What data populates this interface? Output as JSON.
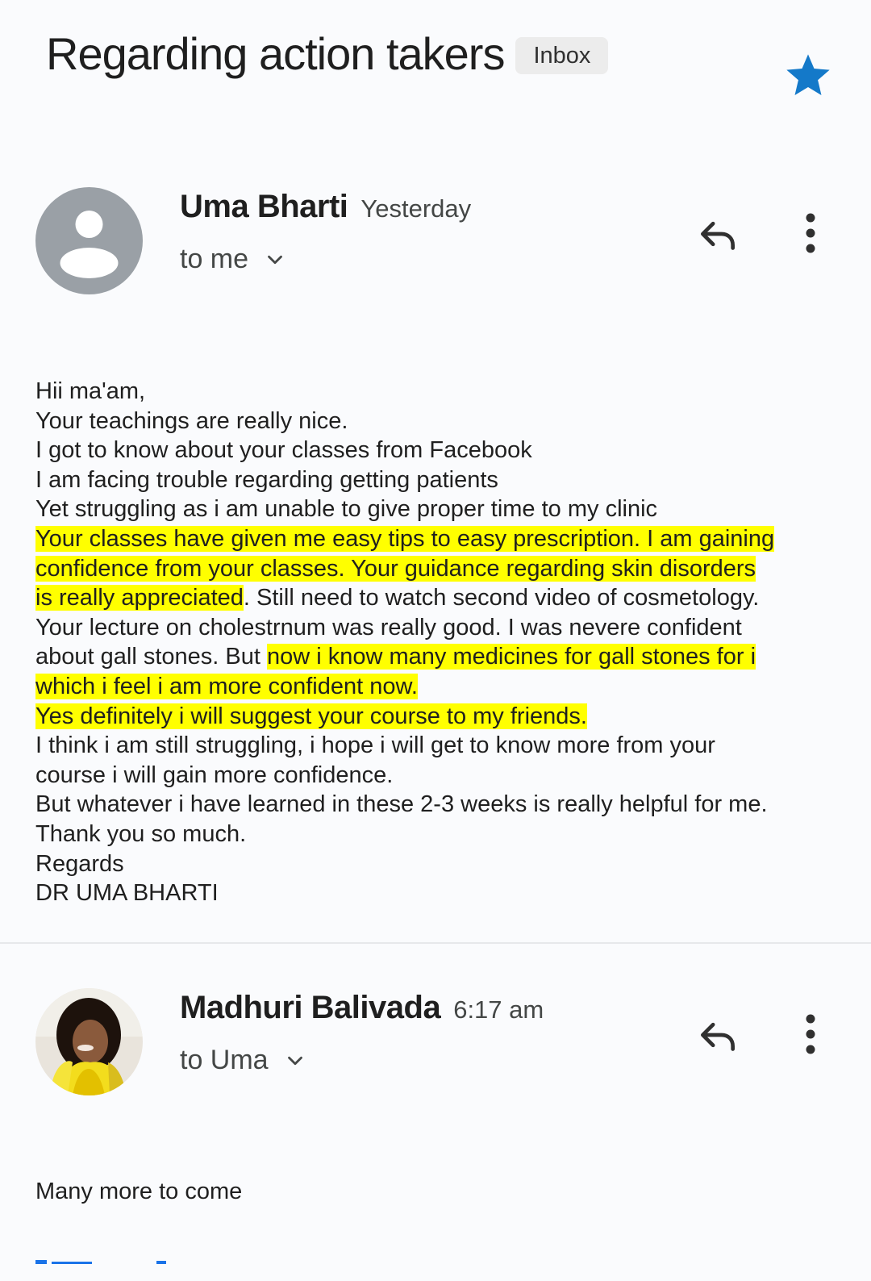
{
  "header": {
    "subject": "Regarding action takers",
    "label_badge": "Inbox",
    "star_icon": "star-icon",
    "star_color": "#1a73e8"
  },
  "messages": [
    {
      "sender": "Uma Bharti",
      "time": "Yesterday",
      "recipient": "to me",
      "avatar": "default-person-avatar",
      "body_lines": [
        [
          {
            "t": "Hii ma'am,",
            "hl": false
          }
        ],
        [
          {
            "t": "Your teachings are really nice.",
            "hl": false
          }
        ],
        [
          {
            "t": "I got to know about your classes from Facebook",
            "hl": false
          }
        ],
        [
          {
            "t": "I am facing trouble regarding getting patients",
            "hl": false
          }
        ],
        [
          {
            "t": "Yet struggling as i am unable to give proper time to my clinic",
            "hl": false
          }
        ],
        [
          {
            "t": "Your classes have given me easy tips to easy prescription. I am gaining",
            "hl": true
          }
        ],
        [
          {
            "t": "confidence from your classes.  Your guidance regarding skin disorders",
            "hl": true
          }
        ],
        [
          {
            "t": "is really appreciated",
            "hl": true
          },
          {
            "t": ". Still need to watch second video of cosmetology.",
            "hl": false
          }
        ],
        [
          {
            "t": "Your lecture on cholestrnum was really good.  I was nevere confident",
            "hl": false
          }
        ],
        [
          {
            "t": "about gall stones. But ",
            "hl": false
          },
          {
            "t": "now i know many medicines for gall stones for i",
            "hl": true
          }
        ],
        [
          {
            "t": "which i feel i am more confident now.",
            "hl": true
          }
        ],
        [
          {
            "t": "Yes definitely i will suggest your course to my friends.",
            "hl": true
          }
        ],
        [
          {
            "t": "I think i am still struggling, i hope i will get to know more from your",
            "hl": false
          }
        ],
        [
          {
            "t": "course i will gain more confidence.",
            "hl": false
          }
        ],
        [
          {
            "t": "But whatever i have learned in these 2-3 weeks is really helpful for me.",
            "hl": false
          }
        ],
        [
          {
            "t": "Thank you so much.",
            "hl": false
          }
        ],
        [
          {
            "t": "Regards",
            "hl": false
          }
        ],
        [
          {
            "t": "DR UMA BHARTI",
            "hl": false
          }
        ]
      ]
    },
    {
      "sender": "Madhuri Balivada",
      "time": "6:17 am",
      "recipient": "to Uma",
      "avatar": "profile-photo-avatar",
      "body_lines": [
        [
          {
            "t": "Many more to come",
            "hl": false
          }
        ]
      ]
    }
  ],
  "icons": {
    "reply": "reply-icon",
    "more": "more-vert-icon",
    "chevron": "chevron-down-icon"
  },
  "colors": {
    "highlight": "#ffff00",
    "text": "#1f1f1f",
    "secondary": "#444746",
    "icon": "#444746"
  }
}
